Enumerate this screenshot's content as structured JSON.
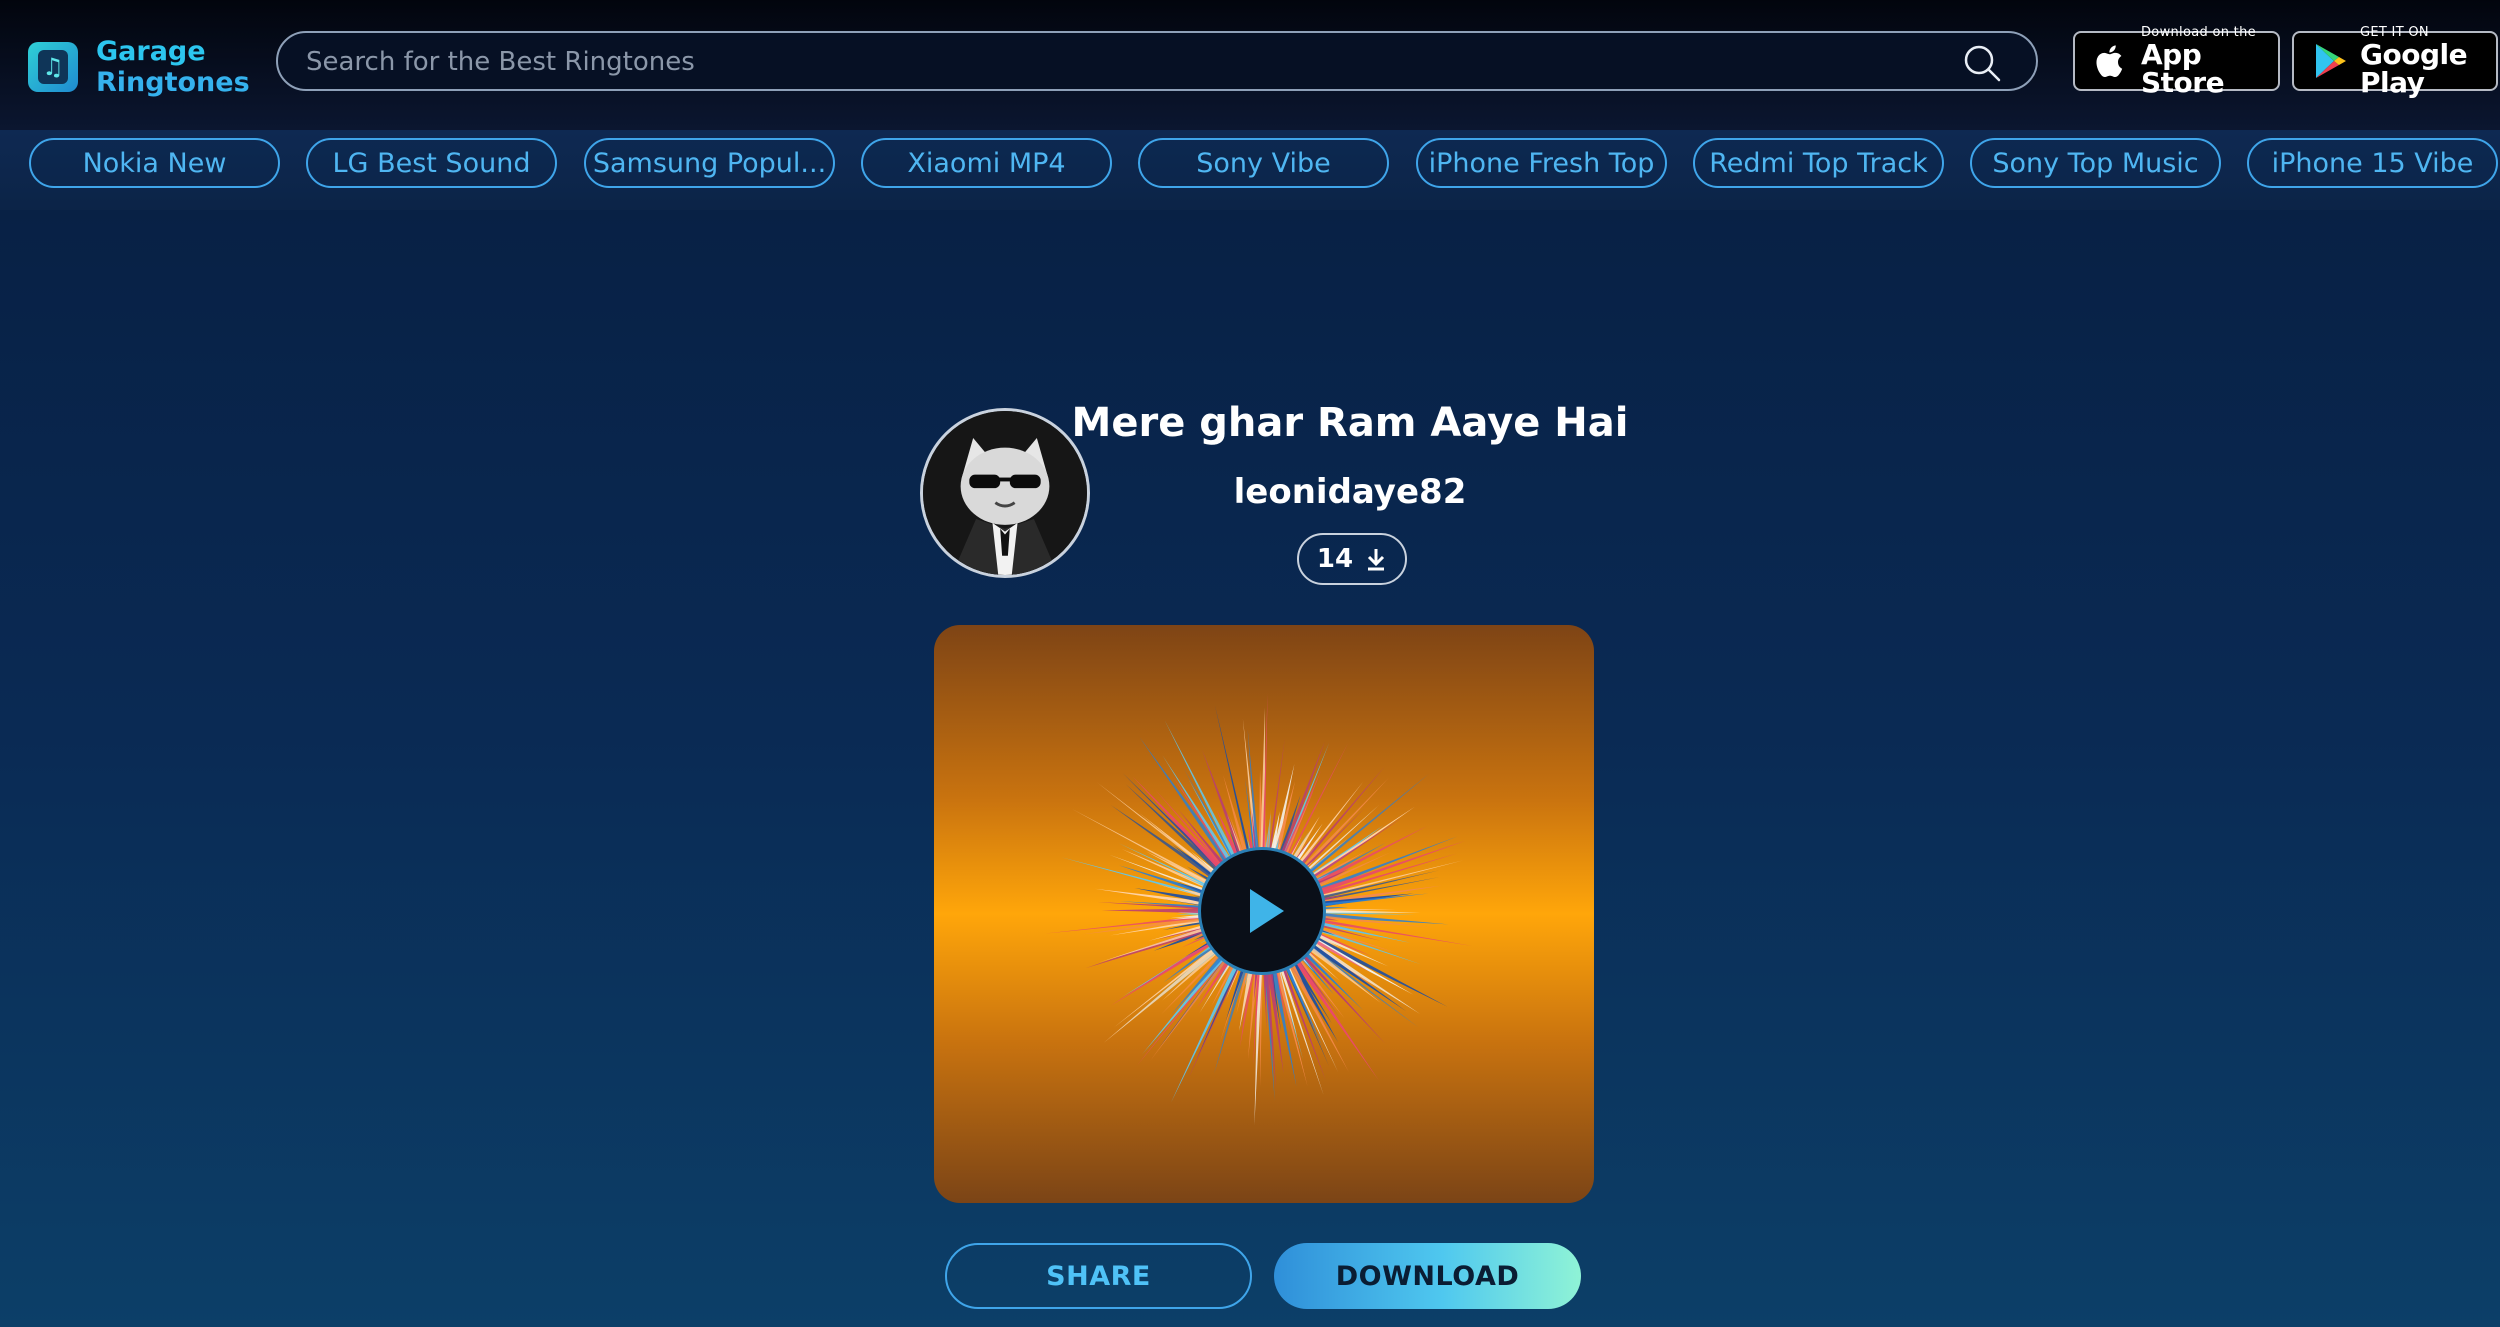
{
  "header": {
    "logo": {
      "line1": "Garage",
      "line2": "Ringtones",
      "icon": "music-note-icon"
    },
    "search": {
      "placeholder": "Search for the Best Ringtones",
      "value": "",
      "icon": "search-icon"
    },
    "app_store": {
      "small": "Download on the",
      "big": "App Store",
      "icon": "apple-icon"
    },
    "google_play": {
      "small": "GET IT ON",
      "big": "Google Play",
      "icon": "play-store-icon"
    }
  },
  "categories": [
    "Nokia New",
    "LG Best Sound",
    "Samsung Popul...",
    "Xiaomi MP4",
    "Sony Vibe",
    "iPhone Fresh Top",
    "Redmi Top Track",
    "Sony Top Music",
    "iPhone 15 Vibe"
  ],
  "ringtone": {
    "title": "Mere ghar Ram Aaye Hai",
    "author": "leonidaye82",
    "downloads": "14",
    "download_icon": "download-icon",
    "avatar_icon": "cat-avatar-icon"
  },
  "actions": {
    "share": "SHARE",
    "download": "DOWNLOAD"
  },
  "colors": {
    "accent": "#3fa5ea",
    "art_orange": "#ffa60a",
    "background": "#0a2a54"
  }
}
